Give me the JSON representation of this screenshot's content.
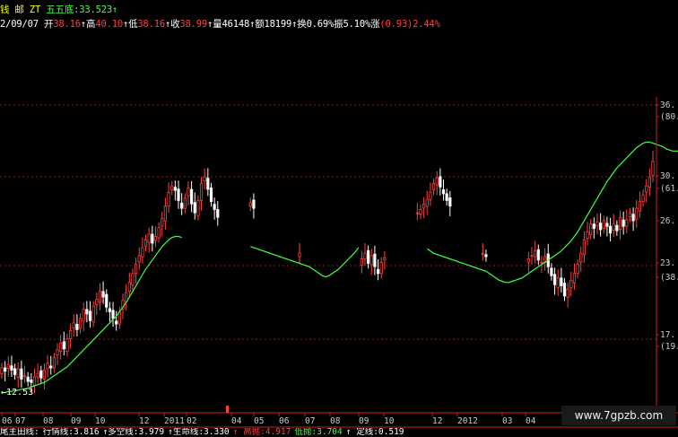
{
  "header": {
    "line1": {
      "prefix": "钱 邮 ZT",
      "ma_name": "五五底",
      "ma_value": ":33.523",
      "ma_arrow": "↑"
    },
    "line2": [
      {
        "label": "2/09/07",
        "value": "",
        "color": "#ffffff"
      },
      {
        "label": " 开",
        "value": "38.16",
        "arrow": "↑",
        "color": "#ff4040"
      },
      {
        "label": "高",
        "value": "40.10",
        "arrow": "↑",
        "color": "#ff4040"
      },
      {
        "label": "低",
        "value": "38.16",
        "arrow": "↑",
        "color": "#ff4040"
      },
      {
        "label": "收",
        "value": "38.99",
        "arrow": "↑",
        "color": "#ff4040"
      },
      {
        "label": "量",
        "value": "46148",
        "arrow": "↑",
        "color": "#ffffff"
      },
      {
        "label": "额",
        "value": "18199",
        "arrow": "↑",
        "color": "#ffffff"
      },
      {
        "label": "换",
        "value": "0.69%",
        "arrow": "",
        "color": "#ffffff"
      },
      {
        "label": "振",
        "value": "5.10%",
        "arrow": "",
        "color": "#ffffff"
      },
      {
        "label": "涨",
        "value": "(0.93)2.44%",
        "arrow": "",
        "color": "#ff4040"
      }
    ]
  },
  "chart_data": {
    "type": "candlestick",
    "x_tick_labels": [
      "06",
      "07",
      "08",
      "09",
      "10",
      "12",
      "2011",
      "02",
      "04",
      "05",
      "06",
      "07",
      "08",
      "09",
      "10",
      "12",
      "2012",
      "03",
      "04"
    ],
    "y_tick_labels": [
      "36.",
      "(80.9",
      "30.",
      "(61.8",
      "26.",
      "23.",
      "(38.2",
      "17.",
      "(19.1"
    ],
    "low_annotation": "←12.53",
    "ylim": [
      11,
      38
    ],
    "watermark": "www.7gpzb.com",
    "footer": {
      "items": [
        {
          "text": "尾主田线:",
          "color": "#ffffff"
        },
        {
          "text": "行情线:3.816",
          "color": "#ffffff"
        },
        {
          "text": "↑多空线:3.979",
          "color": "#ffffff"
        },
        {
          "text": "↑生命线:3.330",
          "color": "#ffffff"
        },
        {
          "text": "↑ 高抛:4.917",
          "color": "#ff4040"
        },
        {
          "text": "低抛:3.704",
          "color": "#4cff4c"
        },
        {
          "text": "↑ 定线:0.519",
          "color": "#ffffff"
        }
      ]
    },
    "series": [
      {
        "kind": "ohlc",
        "x": [
          0,
          1,
          2,
          3,
          4,
          5,
          6,
          7,
          8,
          9,
          10,
          11,
          12,
          13,
          14,
          15,
          16,
          17,
          18,
          19,
          20,
          21,
          22,
          23,
          24,
          25,
          26,
          27,
          28,
          29,
          30,
          31,
          32,
          33,
          34,
          35,
          36,
          37,
          38,
          39,
          40,
          41,
          42,
          43,
          44,
          45,
          46,
          47,
          48,
          49,
          50,
          51,
          52,
          53,
          54,
          55,
          56,
          57,
          58,
          59,
          60,
          61,
          62,
          63,
          64,
          65,
          66,
          67,
          68,
          69,
          70,
          71,
          72,
          73,
          74,
          75,
          76,
          77,
          78,
          79,
          80,
          81,
          82,
          83,
          84,
          85,
          86,
          87,
          88,
          89,
          90,
          91,
          92,
          93,
          94,
          95,
          96,
          97,
          98,
          99,
          100,
          101,
          102,
          103,
          104,
          105,
          106,
          107,
          108,
          109,
          110,
          111,
          112,
          113,
          114,
          115,
          116,
          117,
          118,
          119,
          120,
          121,
          122,
          123,
          124,
          125,
          126,
          127,
          128,
          129,
          130,
          131,
          132,
          133,
          134,
          135,
          136,
          137,
          138,
          139,
          140,
          141,
          142,
          143,
          144,
          145,
          146,
          147,
          148,
          149,
          150,
          151,
          152,
          153,
          154,
          155,
          156,
          157,
          158,
          159,
          160,
          161,
          162,
          163,
          164,
          165,
          166,
          167,
          168,
          169,
          170,
          171,
          172,
          173,
          174,
          175,
          176,
          177,
          178,
          179,
          180,
          181,
          182,
          183,
          184,
          185,
          186,
          187,
          188,
          189,
          190,
          191,
          192,
          193,
          194,
          195,
          196,
          197,
          198,
          199
        ],
        "close": [
          14.2,
          13.9,
          14.5,
          14.0,
          13.6,
          14.1,
          13.2,
          13.5,
          13.0,
          12.9,
          13.4,
          13.7,
          13.3,
          14.0,
          14.6,
          14.2,
          15.1,
          15.8,
          16.4,
          15.9,
          16.8,
          17.5,
          18.2,
          17.6,
          18.6,
          19.4,
          19.0,
          18.4,
          19.7,
          20.3,
          21.0,
          20.5,
          19.6,
          19.2,
          18.6,
          18.1,
          19.2,
          20.2,
          20.9,
          21.8,
          22.6,
          23.4,
          24.2,
          24.9,
          25.6,
          26.1,
          25.3,
          25.9,
          26.7,
          27.5,
          28.6,
          29.8,
          30.4,
          30.0,
          29.1,
          28.4,
          29.3,
          30.2,
          28.8,
          28.0,
          29.1,
          30.6,
          31.2,
          30.1,
          29.0,
          28.3,
          27.6,
          null,
          null,
          null,
          null,
          null,
          null,
          null,
          null,
          null,
          28.9,
          28.4,
          null,
          null,
          null,
          null,
          null,
          null,
          null,
          null,
          null,
          null,
          null,
          null,
          null,
          24.4,
          null,
          null,
          null,
          null,
          null,
          null,
          null,
          null,
          null,
          null,
          null,
          null,
          null,
          null,
          null,
          null,
          null,
          null,
          23.9,
          24.4,
          23.5,
          24.2,
          23.2,
          22.6,
          23.6,
          24.0,
          null,
          null,
          null,
          null,
          null,
          null,
          null,
          null,
          null,
          28.0,
          28.3,
          28.8,
          29.2,
          29.8,
          30.6,
          31.1,
          30.3,
          29.7,
          29.1,
          28.6,
          null,
          null,
          null,
          null,
          null,
          null,
          null,
          null,
          null,
          24.4,
          24.1,
          null,
          null,
          null,
          null,
          null,
          null,
          null,
          null,
          null,
          null,
          null,
          null,
          23.9,
          24.2,
          24.6,
          23.8,
          23.6,
          24.1,
          23.2,
          22.4,
          21.6,
          22.2,
          21.5,
          20.6,
          21.2,
          22.0,
          22.6,
          23.4,
          24.4,
          25.6,
          26.3,
          27.0,
          26.6,
          27.2,
          26.5,
          27.3,
          26.8,
          26.2,
          27.0,
          26.4,
          27.6,
          26.8,
          27.4,
          28.0,
          27.3,
          28.4,
          29.0,
          29.6,
          30.4,
          31.2,
          32.6,
          33.8,
          35.0,
          35.6,
          36.0,
          36.2,
          36.0
        ]
      },
      {
        "kind": "line",
        "name": "",
        "values": [
          12.0,
          12.0,
          12.1,
          12.1,
          12.2,
          12.2,
          12.3,
          12.3,
          12.4,
          12.5,
          12.6,
          12.7,
          12.8,
          12.9,
          13.1,
          13.3,
          13.5,
          13.7,
          13.9,
          14.1,
          14.3,
          14.6,
          14.9,
          15.2,
          15.5,
          15.8,
          16.1,
          16.4,
          16.7,
          17.0,
          17.3,
          17.6,
          17.9,
          18.2,
          18.5,
          18.8,
          19.2,
          19.6,
          20.0,
          20.5,
          21.0,
          21.5,
          22.0,
          22.5,
          23.0,
          23.4,
          23.8,
          24.2,
          24.6,
          25.0,
          25.3,
          25.6,
          25.8,
          25.9,
          25.9,
          25.8,
          null,
          null,
          null,
          null,
          null,
          null,
          null,
          null,
          null,
          null,
          null,
          null,
          null,
          null,
          null,
          null,
          null,
          null,
          null,
          null,
          25.0,
          24.9,
          24.8,
          24.7,
          24.6,
          24.5,
          24.4,
          24.3,
          24.2,
          24.1,
          24.0,
          23.9,
          23.8,
          23.7,
          23.6,
          23.5,
          23.4,
          23.3,
          23.2,
          23.0,
          22.8,
          22.6,
          22.4,
          22.3,
          22.4,
          22.6,
          22.8,
          23.0,
          23.3,
          23.6,
          23.9,
          24.2,
          24.5,
          24.9,
          null,
          null,
          null,
          null,
          null,
          null,
          null,
          null,
          null,
          null,
          null,
          null,
          null,
          null,
          null,
          null,
          null,
          null,
          null,
          null,
          24.8,
          24.6,
          24.4,
          24.3,
          24.2,
          24.1,
          24.0,
          23.9,
          23.8,
          23.7,
          23.6,
          23.5,
          23.4,
          23.3,
          23.2,
          23.1,
          23.0,
          22.9,
          22.8,
          22.6,
          22.4,
          22.2,
          22.0,
          21.9,
          21.8,
          21.8,
          21.9,
          22.0,
          22.1,
          22.2,
          22.4,
          22.6,
          22.8,
          23.0,
          23.2,
          23.4,
          23.6,
          23.8,
          24.0,
          24.2,
          24.4,
          24.6,
          24.9,
          25.2,
          25.5,
          25.9,
          26.3,
          26.8,
          27.3,
          27.8,
          28.3,
          28.8,
          29.3,
          29.8,
          30.3,
          30.8,
          31.2,
          31.6,
          32.0,
          32.3,
          32.6,
          32.9,
          33.2,
          33.5,
          33.8,
          34.0,
          34.2,
          34.3,
          34.3,
          34.2,
          34.1,
          34.0,
          33.9,
          33.7,
          33.6,
          33.5,
          33.5,
          33.5,
          33.5,
          33.5
        ]
      }
    ]
  },
  "colors": {
    "bull": "#ff4040",
    "bear": "#ffffff",
    "ma": "#40ff40",
    "grid": "#8b1a1a",
    "axis": "#cc2020",
    "text": "#c8c8c8"
  }
}
